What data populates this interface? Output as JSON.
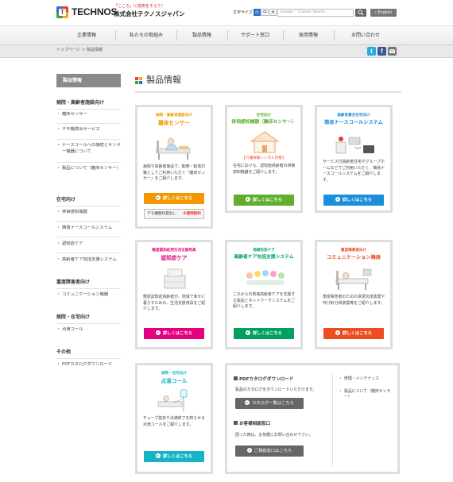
{
  "header": {
    "logo_mark": "T",
    "logo_text": "TECHNOS",
    "tagline": "「こころ」に技術をそえて！",
    "company": "株式会社テクノスジャパン",
    "font_size_label": "文字サイズ",
    "font_sizes": [
      "小",
      "中",
      "大"
    ],
    "search_placeholder": "Google™ Custom Search",
    "english_label": "› English"
  },
  "nav": [
    "企業情報",
    "私たちの取組み",
    "製品情報",
    "サポート窓口",
    "採用情報",
    "お問い合わせ"
  ],
  "breadcrumb": "トップページ ＞ 製品情報",
  "share_icons": [
    "twitter-icon",
    "facebook-icon",
    "mail-icon"
  ],
  "sidebar": {
    "heading": "製品情報",
    "groups": [
      {
        "title": "病院・高齢者施設向け",
        "items": [
          "離床センサー",
          "デモ機貸出サービス",
          "ナースコールへの接続とセンサー機器について",
          "製品について（離床センサー）"
        ]
      },
      {
        "title": "在宅向け",
        "items": [
          "徘徊感知機器",
          "簡易ナースコールシステム",
          "認知症ケア",
          "高齢者ケア包括支援システム"
        ]
      },
      {
        "title": "重度障害者向け",
        "items": [
          "コミュニケーション機器"
        ]
      },
      {
        "title": "病院・在宅向け",
        "items": [
          "点滴コール"
        ]
      },
      {
        "title": "その他",
        "items": [
          "PDFカタログダウンロード"
        ]
      }
    ]
  },
  "main": {
    "title": "製品情報",
    "button_label": "詳しくはこちら",
    "cards": [
      {
        "category": "病院・高齢者施設向け",
        "name": "離床センサー",
        "desc": "病院や高齢者施設で、転倒・転落対策としてご利用いただく「離床センサー」をご紹介します。",
        "color": "#f39800",
        "demo_label": "デモ機無料貸出し",
        "demo_badge": "※要問無料"
      },
      {
        "category": "在宅向け",
        "name": "徘徊感知機器（離床センサー）",
        "badge": "【介護保険レンタル対象】",
        "desc": "在宅における、認知症高齢者の徘徊感知機器をご紹介します。",
        "color": "#5fae2e"
      },
      {
        "category": "高齢者集合住宅向け",
        "name": "簡易ナースコールシステム",
        "desc": "サービス付高齢者住宅やグループホームなどでご利用いただく、簡易ナースコールシステムをご紹介します。",
        "color": "#1b8fd8"
      },
      {
        "category": "軽度認知症用生活支援用具",
        "name": "認知症ケア",
        "desc": "軽度認知症高齢者が、地域で幸せに暮らすための、生活支援用具をご紹介します。",
        "color": "#e4007f"
      },
      {
        "category": "地域包括ケア",
        "name": "高齢者ケア包括支援システム",
        "desc": "これからの地域高齢者ケアを支援する製品とネットワークシステムをご紹介します。",
        "color": "#00a15e"
      },
      {
        "category": "重度障害者向け",
        "name": "コミュニケーション機器",
        "desc": "重度障害者のための意思伝達装置や呼び鈴分岐装置等をご紹介します。",
        "color": "#ec4e21"
      },
      {
        "category": "病院・在宅向け",
        "name": "点滴コール",
        "desc": "チューブ抜去や点滴終了を知らせる点滴コールをご紹介します。",
        "color": "#17b5c4"
      }
    ],
    "info": {
      "pdf_title": "PDFカタログダウンロード",
      "pdf_text": "製品のカタログをダウンロードいただけます。",
      "pdf_button": "カタログ一覧はこちら",
      "consult_title": "お客様相談窓口",
      "consult_text": "困った時は、お気軽にお問い合わせ下さい。",
      "consult_button": "ご相談窓口はこちら",
      "links": [
        "修理・メンテナンス",
        "製品について（離床センサー）"
      ]
    }
  }
}
